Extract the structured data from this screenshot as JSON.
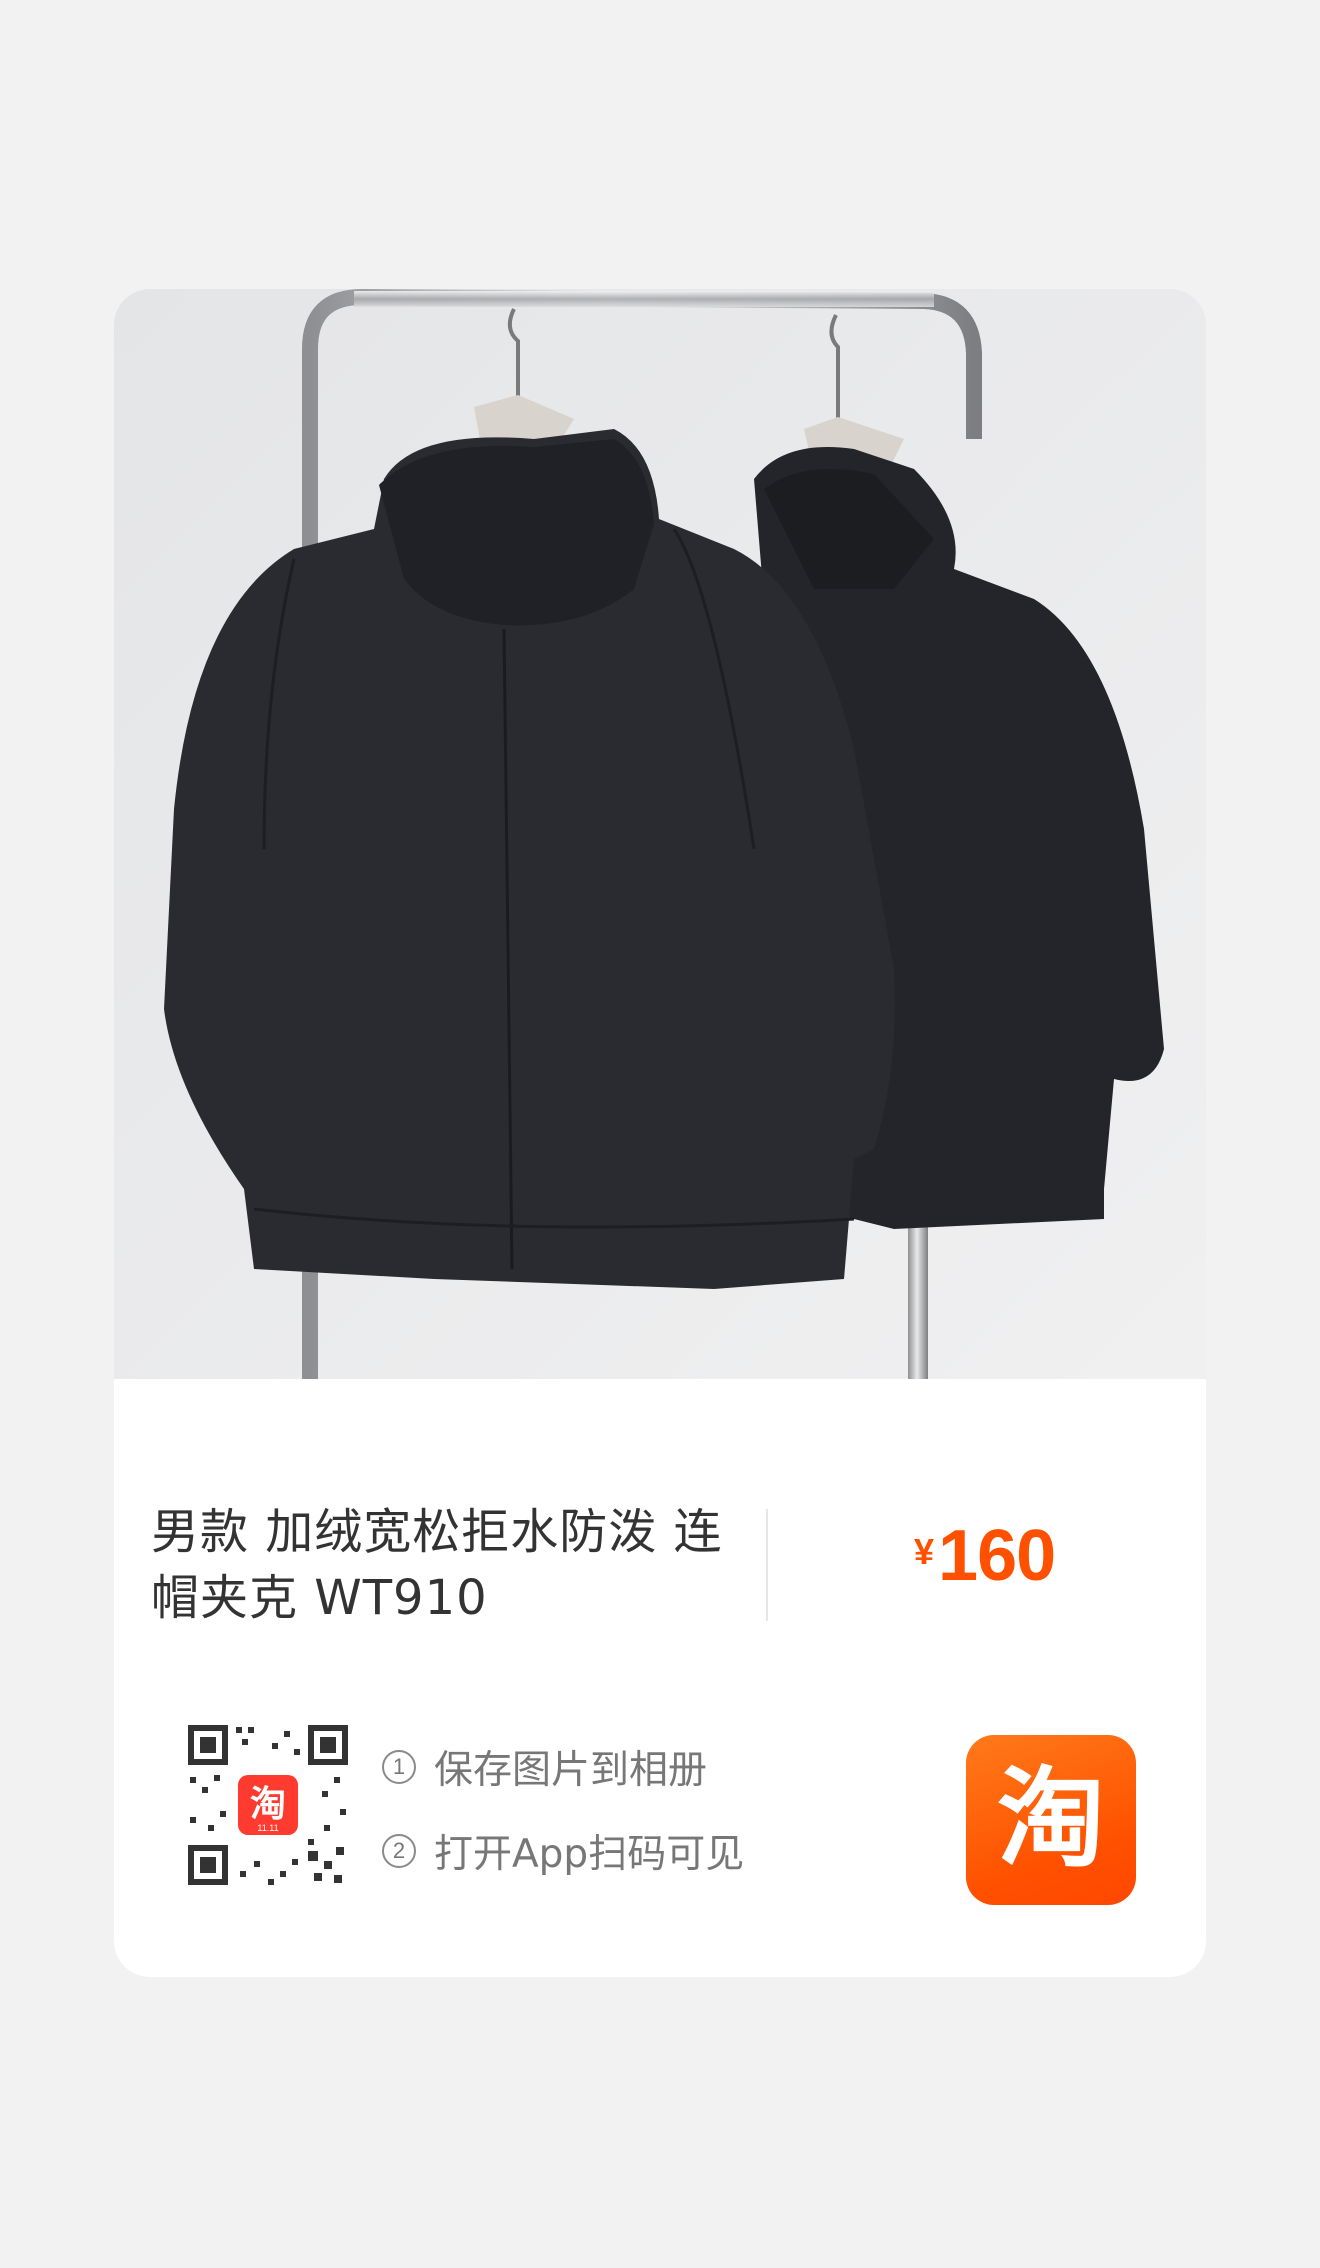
{
  "product": {
    "title_line1": "男款 加绒宽松拒水防泼 连",
    "title_line2": "帽夹克 WT910",
    "currency": "¥",
    "price": "160"
  },
  "share": {
    "step1_num": "1",
    "step1_text": "保存图片到相册",
    "step2_num": "2",
    "step2_text": "打开App扫码可见"
  },
  "qr_badge": {
    "glyph": "淘",
    "tag": "11.11"
  },
  "logo": {
    "glyph": "淘"
  },
  "colors": {
    "price": "#ff5000",
    "logo_bg": "#ff5000",
    "page_bg": "#f2f2f2"
  },
  "icons": [
    "qr-code-icon",
    "taobao-logo-icon"
  ]
}
